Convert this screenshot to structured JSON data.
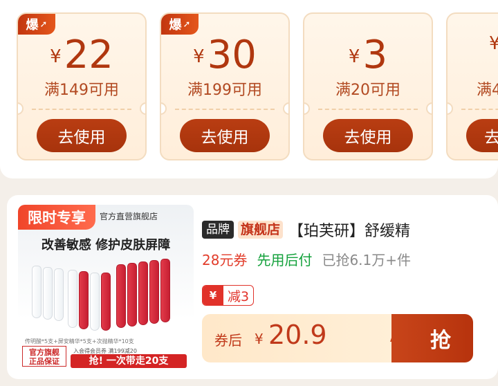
{
  "coupons": [
    {
      "badge": "爆",
      "currency": "¥",
      "amount": "22",
      "condition": "满149可用",
      "button": "去使用"
    },
    {
      "badge": "爆",
      "currency": "¥",
      "amount": "30",
      "condition": "满199可用",
      "button": "去使用"
    },
    {
      "badge": "",
      "currency": "¥",
      "amount": "3",
      "condition": "满20可用",
      "button": "去使用"
    },
    {
      "badge": "",
      "currency": "¥",
      "amount": "",
      "condition": "满4",
      "button": "去"
    }
  ],
  "product": {
    "image": {
      "promo_tag": "限时专享",
      "shop_name": "官方直营旗舰店",
      "headline": "改善敏感 修护皮肤屏障",
      "ingredient_note": "传明酸*5支+屏安精华*5支+次抛精华*10支",
      "brand_box_line1": "官方旗舰",
      "brand_box_line2": "正品保证",
      "member_note": "入会得会员券 满199减20",
      "grab_banner": "抢! 一次带走20支"
    },
    "tag_brand": "品牌",
    "tag_flagship": "旗舰店",
    "title": "【珀芙研】舒缓精",
    "coupon_text": "28元券",
    "pay_later": "先用后付",
    "sold": "已抢6.1万+件",
    "discount_icon": "¥",
    "discount": "减3",
    "price_label": "券后",
    "price_currency": "¥",
    "price": "20.9",
    "grab_button": "抢"
  },
  "colors": {
    "accent": "#b0370f",
    "button": "#a7330c",
    "price": "#c0391a",
    "coupon_red": "#e23c2a",
    "pay_later_green": "#14a13c"
  }
}
